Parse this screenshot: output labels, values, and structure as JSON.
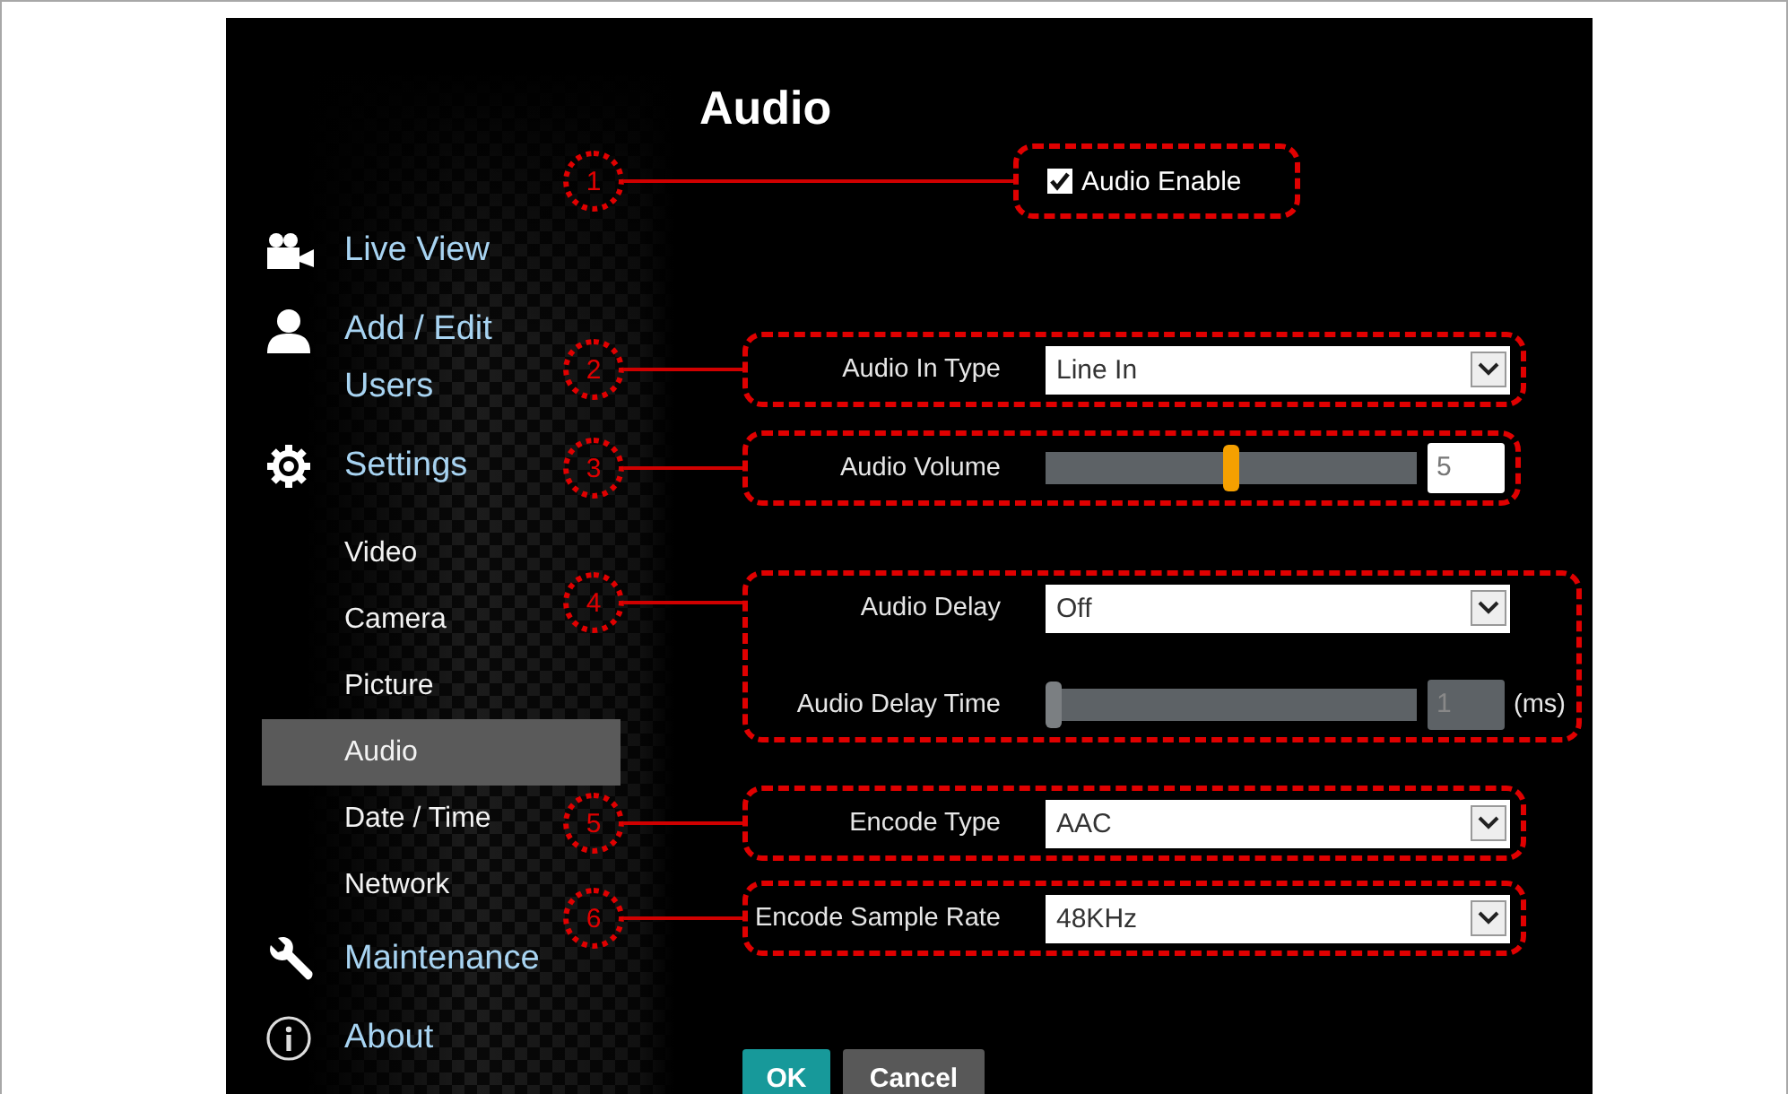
{
  "sidebar": {
    "items": [
      {
        "label": "Live View"
      },
      {
        "label": "Add / Edit Users"
      },
      {
        "label": "Settings",
        "children": [
          {
            "label": "Video",
            "selected": false
          },
          {
            "label": "Camera",
            "selected": false
          },
          {
            "label": "Picture",
            "selected": false
          },
          {
            "label": "Audio",
            "selected": true
          },
          {
            "label": "Date / Time",
            "selected": false
          },
          {
            "label": "Network",
            "selected": false
          }
        ]
      },
      {
        "label": "Maintenance"
      },
      {
        "label": "About"
      }
    ]
  },
  "page": {
    "title": "Audio"
  },
  "callouts": [
    {
      "number": "1",
      "fields": [
        {
          "kind": "checkbox",
          "label": "Audio Enable",
          "checked": true
        }
      ]
    },
    {
      "number": "2",
      "fields": [
        {
          "kind": "select",
          "label": "Audio In Type",
          "value": "Line In"
        }
      ]
    },
    {
      "number": "3",
      "fields": [
        {
          "kind": "slider",
          "label": "Audio Volume",
          "level": 0.5,
          "value": "5",
          "disabled": false
        }
      ]
    },
    {
      "number": "4",
      "fields": [
        {
          "kind": "select",
          "label": "Audio Delay",
          "value": "Off"
        },
        {
          "kind": "slider",
          "label": "Audio Delay Time",
          "level": 0,
          "value": "1",
          "disabled": true,
          "unit": "(ms)"
        }
      ]
    },
    {
      "number": "5",
      "fields": [
        {
          "kind": "select",
          "label": "Encode Type",
          "value": "AAC"
        }
      ]
    },
    {
      "number": "6",
      "fields": [
        {
          "kind": "select",
          "label": "Encode Sample Rate",
          "value": "48KHz"
        }
      ]
    }
  ],
  "buttons": [
    {
      "label": "OK",
      "kind": "primary"
    },
    {
      "label": "Cancel",
      "kind": "secondary"
    }
  ]
}
